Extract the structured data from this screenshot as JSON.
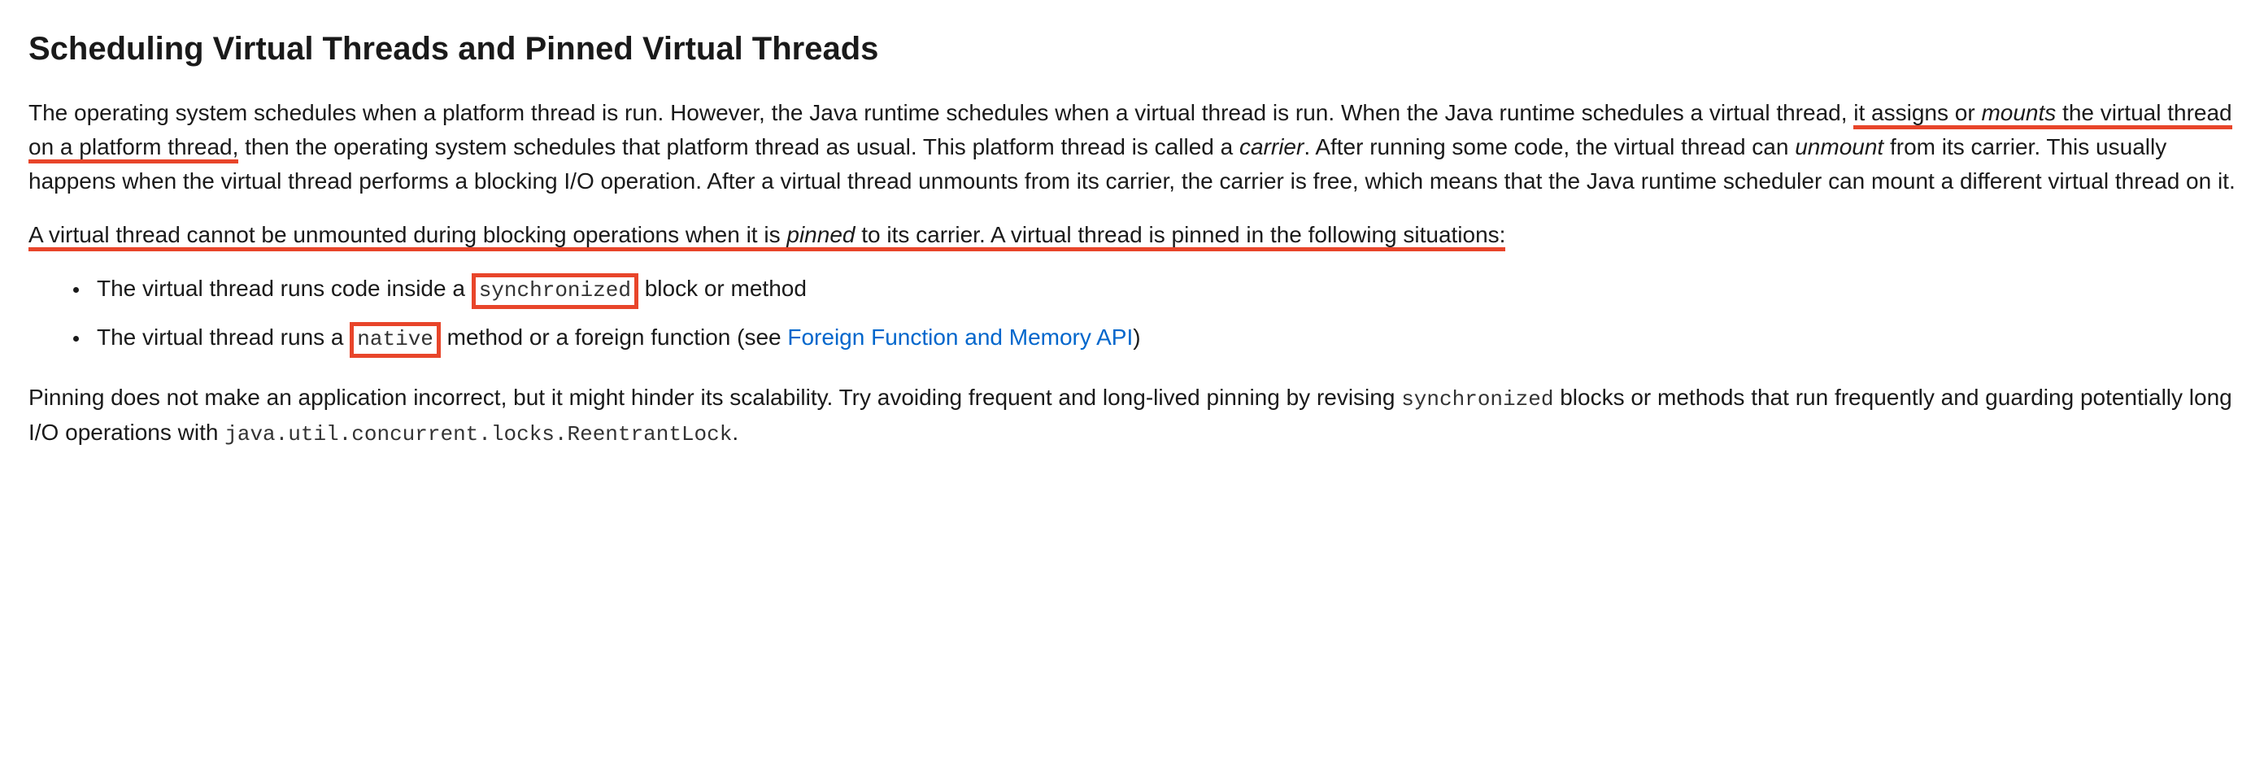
{
  "heading": "Scheduling Virtual Threads and Pinned Virtual Threads",
  "p1": {
    "t1": "The operating system schedules when a platform thread is run. However, the Java runtime schedules when a virtual thread is run. When the Java runtime schedules a virtual thread, ",
    "underlined1a": "it assigns or ",
    "underlined1b": "mounts",
    "underlined1c": " the virtual thread on a platform thread,",
    "t2": " then the operating system schedules that platform thread as usual. This platform thread is called a ",
    "i1": "carrier",
    "t3": ". After running some code, the virtual thread can ",
    "i2": "unmount",
    "t4": " from its carrier. This usually happens when the virtual thread performs a blocking I/O operation. After a virtual thread unmounts from its carrier, the carrier is free, which means that the Java runtime scheduler can mount a different virtual thread on it."
  },
  "p2": {
    "t1": "A virtual thread cannot be unmounted during blocking operations when it is ",
    "i1": "pinned",
    "t2": " to its carrier. A virtual thread is pinned in the following situations:"
  },
  "li1": {
    "t1": "The virtual thread runs code inside a ",
    "boxed": "synchronized",
    "t2": " block or method"
  },
  "li2": {
    "t1": "The virtual thread runs a ",
    "boxed": "native",
    "t2": " method or a foreign function (see ",
    "link": "Foreign Function and Memory API",
    "t3": ")"
  },
  "p3": {
    "t1": "Pinning does not make an application incorrect, but it might hinder its scalability. Try avoiding frequent and long-lived pinning by revising ",
    "c1": "synchronized",
    "t2": " blocks or methods that run frequently and guarding potentially long I/O operations with ",
    "c2": "java.util.concurrent.locks.ReentrantLock",
    "t3": "."
  }
}
